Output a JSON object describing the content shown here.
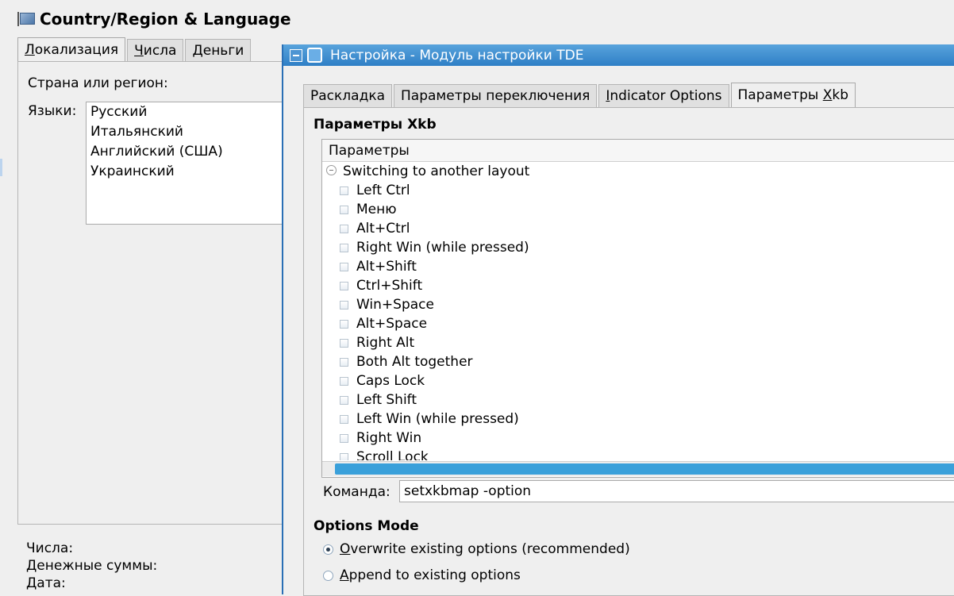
{
  "bg_window": {
    "title": "Country/Region & Language",
    "tabs": [
      {
        "pre": "",
        "key": "Л",
        "post": "окализация"
      },
      {
        "pre": "",
        "key": "Ч",
        "post": "исла"
      },
      {
        "pre": "",
        "key": "Д",
        "post": "еньги"
      }
    ],
    "country_label": "Страна или регион:",
    "languages_label": "Языки:",
    "languages": [
      "Русский",
      "Итальянский",
      "Английский (США)",
      "Украинский"
    ],
    "bottom_labels": [
      "Числа:",
      "Денежные суммы:",
      "Дата:"
    ]
  },
  "dialog": {
    "title": "Настройка - Модуль настройки TDE",
    "tabs": [
      {
        "pre": "Раскладка",
        "key": "",
        "post": ""
      },
      {
        "pre": "Параметры переключения",
        "key": "",
        "post": ""
      },
      {
        "pre": "",
        "key": "I",
        "post": "ndicator Options"
      },
      {
        "pre": "Параметры ",
        "key": "X",
        "post": "kb"
      }
    ],
    "xkb_heading": "Параметры Xkb",
    "tree_header": "Параметры",
    "tree_group": "Switching to another layout",
    "tree_items": [
      "Left Ctrl",
      "Меню",
      "Alt+Ctrl",
      "Right Win (while pressed)",
      "Alt+Shift",
      "Ctrl+Shift",
      "Win+Space",
      "Alt+Space",
      "Right Alt",
      "Both Alt together",
      "Caps Lock",
      "Left Shift",
      "Left Win (while pressed)",
      "Right Win",
      "Scroll Lock"
    ],
    "command_label": "Команда:",
    "command_value": "setxkbmap -option",
    "options_mode_heading": "Options Mode",
    "options": [
      {
        "key": "O",
        "rest": "verwrite existing options (recommended)",
        "selected": true
      },
      {
        "key": "A",
        "rest": "ppend to existing options",
        "selected": false
      }
    ]
  }
}
